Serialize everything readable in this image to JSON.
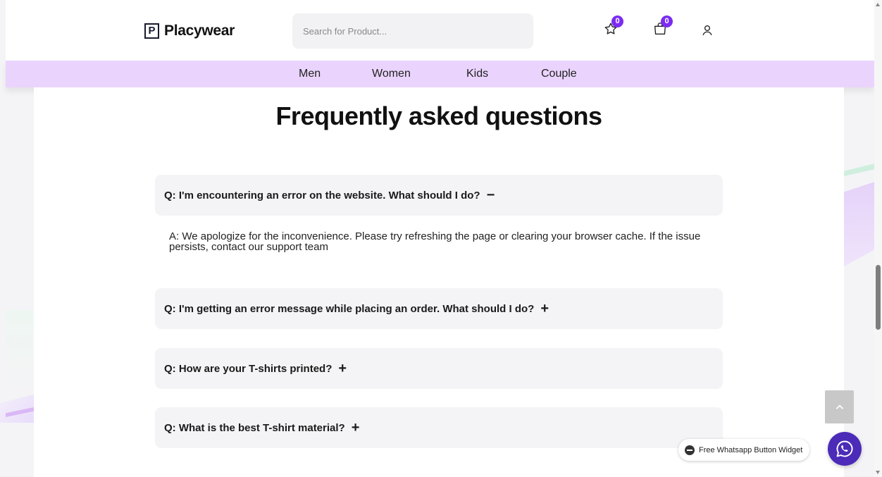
{
  "header": {
    "logo_letter": "P",
    "logo_text": "Placywear",
    "search_placeholder": "Search for Product...",
    "wishlist_count": "0",
    "cart_count": "0"
  },
  "nav": {
    "items": [
      {
        "label": "Men"
      },
      {
        "label": "Women"
      },
      {
        "label": "Kids"
      },
      {
        "label": "Couple"
      }
    ]
  },
  "faq": {
    "title": "Frequently asked questions",
    "items": [
      {
        "question": "Q: I'm encountering an error on the website. What should I do?",
        "toggle": "−",
        "expanded": true,
        "answer": "A: We apologize for the inconvenience. Please try refreshing the page or clearing your browser cache. If the issue persists, contact our support team"
      },
      {
        "question": "Q: I'm getting an error message while placing an order. What should I do?",
        "toggle": "+",
        "expanded": false
      },
      {
        "question": "Q: How are your T-shirts printed?",
        "toggle": "+",
        "expanded": false
      },
      {
        "question": "Q: What is the best T-shirt material?",
        "toggle": "+",
        "expanded": false
      }
    ]
  },
  "widgets": {
    "whatsapp_label": "Free Whatsapp Button Widget"
  },
  "colors": {
    "accent": "#7b2cf0",
    "nav_bg": "#ead4fd",
    "whatsapp_btn": "#4b2bb8"
  }
}
